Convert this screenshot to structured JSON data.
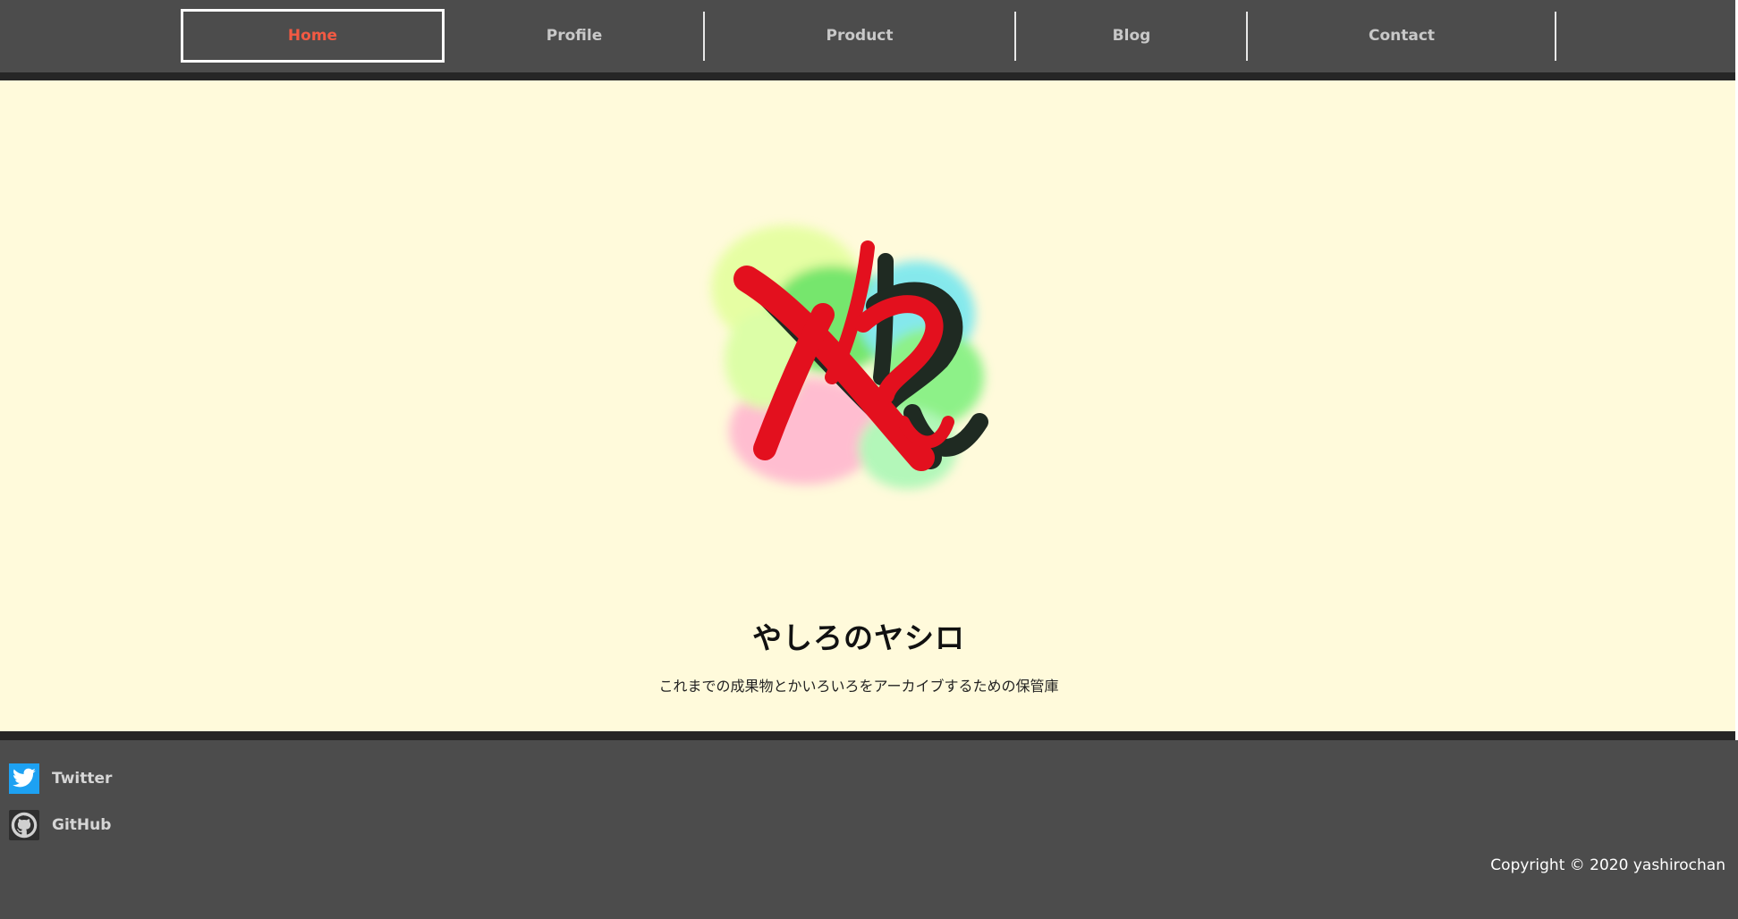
{
  "nav": {
    "items": [
      {
        "label": "Home",
        "active": true
      },
      {
        "label": "Profile",
        "active": false
      },
      {
        "label": "Product",
        "active": false
      },
      {
        "label": "Blog",
        "active": false
      },
      {
        "label": "Contact",
        "active": false
      }
    ]
  },
  "hero": {
    "logo_icon": "yashiro-logo-icon",
    "title": "やしろのヤシロ",
    "description": "これまでの成果物とかいろいろをアーカイブするための保管庫"
  },
  "footer": {
    "social": [
      {
        "label": "Twitter",
        "icon": "twitter-icon"
      },
      {
        "label": "GitHub",
        "icon": "github-icon"
      }
    ],
    "copyright": "Copyright © 2020 yashirochan"
  },
  "colors": {
    "nav_bg": "#4c4c4c",
    "strip": "#262626",
    "hero_bg": "#fffadb",
    "active_nav_text": "#f35a43",
    "nav_text": "#c8c8c8",
    "twitter_blue": "#1da1f2"
  }
}
